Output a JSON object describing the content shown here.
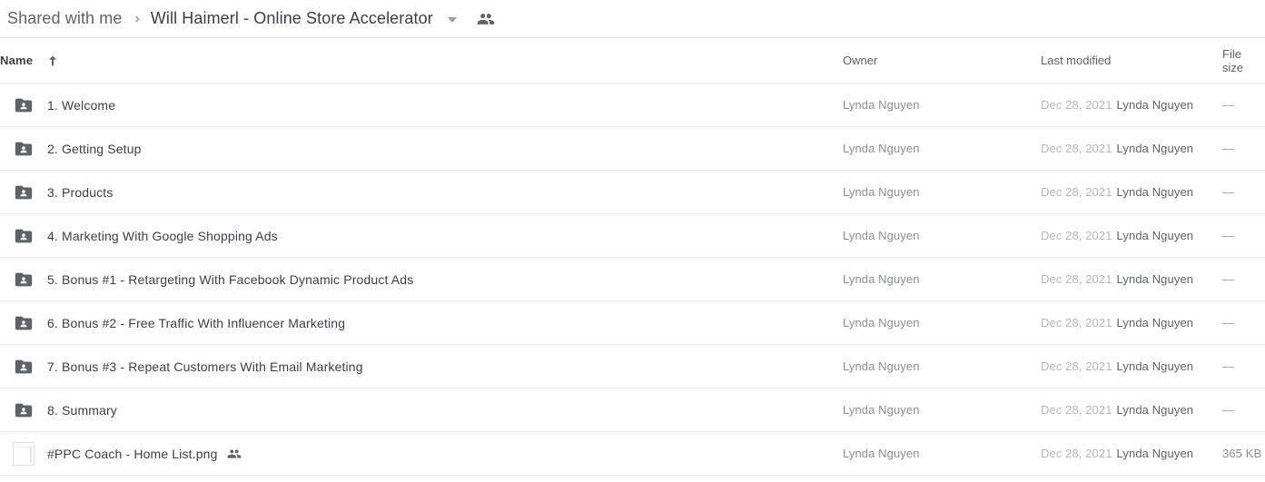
{
  "breadcrumb": {
    "root": "Shared with me",
    "separator": "›",
    "current": "Will Haimerl - Online Store Accelerator",
    "caret_icon": "chevron-down-icon",
    "people_icon": "people-shared-icon"
  },
  "columns": {
    "name": "Name",
    "sort_icon": "sort-arrow-up-icon",
    "owner": "Owner",
    "last_modified": "Last modified",
    "file_size": "File size"
  },
  "rows": [
    {
      "icon": "shared-folder-icon",
      "name": "1. Welcome",
      "shared_badge": false,
      "owner": "Lynda Nguyen",
      "modified_date": "Dec 28, 2021",
      "modified_by": "Lynda Nguyen",
      "size": "—"
    },
    {
      "icon": "shared-folder-icon",
      "name": "2. Getting Setup",
      "shared_badge": false,
      "owner": "Lynda Nguyen",
      "modified_date": "Dec 28, 2021",
      "modified_by": "Lynda Nguyen",
      "size": "—"
    },
    {
      "icon": "shared-folder-icon",
      "name": "3. Products",
      "shared_badge": false,
      "owner": "Lynda Nguyen",
      "modified_date": "Dec 28, 2021",
      "modified_by": "Lynda Nguyen",
      "size": "—"
    },
    {
      "icon": "shared-folder-icon",
      "name": "4. Marketing With Google Shopping Ads",
      "shared_badge": false,
      "owner": "Lynda Nguyen",
      "modified_date": "Dec 28, 2021",
      "modified_by": "Lynda Nguyen",
      "size": "—"
    },
    {
      "icon": "shared-folder-icon",
      "name": "5. Bonus #1 - Retargeting With Facebook Dynamic Product Ads",
      "shared_badge": false,
      "owner": "Lynda Nguyen",
      "modified_date": "Dec 28, 2021",
      "modified_by": "Lynda Nguyen",
      "size": "—"
    },
    {
      "icon": "shared-folder-icon",
      "name": "6. Bonus #2 - Free Traffic With Influencer Marketing",
      "shared_badge": false,
      "owner": "Lynda Nguyen",
      "modified_date": "Dec 28, 2021",
      "modified_by": "Lynda Nguyen",
      "size": "—"
    },
    {
      "icon": "shared-folder-icon",
      "name": "7. Bonus #3 - Repeat Customers With Email Marketing",
      "shared_badge": false,
      "owner": "Lynda Nguyen",
      "modified_date": "Dec 28, 2021",
      "modified_by": "Lynda Nguyen",
      "size": "—"
    },
    {
      "icon": "shared-folder-icon",
      "name": "8. Summary",
      "shared_badge": false,
      "owner": "Lynda Nguyen",
      "modified_date": "Dec 28, 2021",
      "modified_by": "Lynda Nguyen",
      "size": "—"
    },
    {
      "icon": "image-thumbnail",
      "name": "#PPC Coach - Home List.png",
      "shared_badge": true,
      "shared_badge_icon": "people-shared-icon",
      "owner": "Lynda Nguyen",
      "modified_date": "Dec 28, 2021",
      "modified_by": "Lynda Nguyen",
      "size": "365 KB"
    }
  ],
  "colors": {
    "folder_icon": "#5f6368",
    "text_primary": "#3c4043",
    "text_secondary": "#5f6368",
    "text_muted": "#b4b7ba",
    "row_divider": "#e8eaed"
  }
}
